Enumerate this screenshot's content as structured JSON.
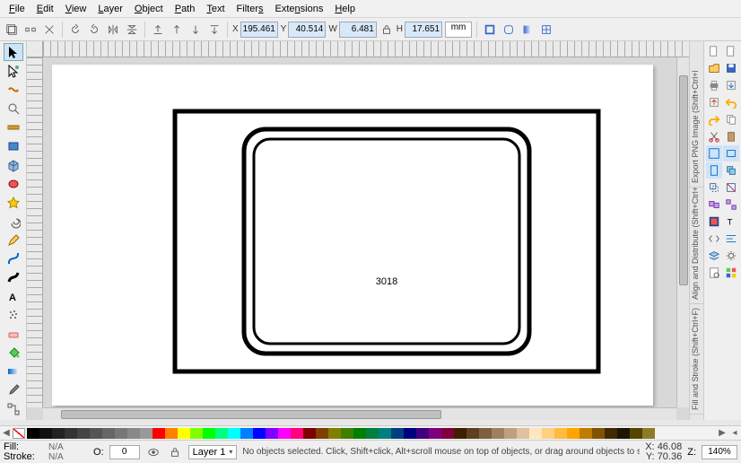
{
  "menu": {
    "items": [
      "File",
      "Edit",
      "View",
      "Layer",
      "Object",
      "Path",
      "Text",
      "Filters",
      "Extensions",
      "Help"
    ]
  },
  "toolbar": {
    "x_label": "X",
    "x_value": "195.461",
    "y_label": "Y",
    "y_value": "40.514",
    "w_label": "W",
    "w_value": "6.481",
    "h_label": "H",
    "h_value": "17.651",
    "unit": "mm"
  },
  "canvas": {
    "big_text": "3018"
  },
  "dock_tabs": [
    "Export PNG Image (Shift+Ctrl+E)",
    "Align and Distribute (Shift+Ctrl+A)",
    "Fill and Stroke (Shift+Ctrl+F)"
  ],
  "palette_colors": [
    "#000000",
    "#111111",
    "#222222",
    "#333333",
    "#444444",
    "#555555",
    "#666666",
    "#777777",
    "#888888",
    "#999999",
    "#ff0000",
    "#ff7f00",
    "#ffff00",
    "#7fff00",
    "#00ff00",
    "#00ff7f",
    "#00ffff",
    "#007fff",
    "#0000ff",
    "#7f00ff",
    "#ff00ff",
    "#ff007f",
    "#7f0000",
    "#7f3f00",
    "#7f7f00",
    "#3f7f00",
    "#007f00",
    "#007f3f",
    "#007f7f",
    "#003f7f",
    "#00007f",
    "#3f007f",
    "#7f007f",
    "#7f003f",
    "#3f1f00",
    "#5f3f1f",
    "#7f5f3f",
    "#9f7f5f",
    "#bf9f7f",
    "#dfc19f",
    "#ffe6bf",
    "#ffd080",
    "#ffba40",
    "#ffa500",
    "#c07c00",
    "#805300",
    "#402a00",
    "#201500",
    "#554400",
    "#8f7a27"
  ],
  "status": {
    "fill_label": "Fill:",
    "stroke_label": "Stroke:",
    "na": "N/A",
    "opacity_label": "O:",
    "opacity_value": "0",
    "layer_name": "Layer 1",
    "hint": "No objects selected. Click, Shift+click, Alt+scroll mouse on top of objects, or drag around objects to select.",
    "x_label": "X:",
    "y_label": "Y:",
    "x_value": "46.08",
    "y_value": "70.36",
    "z_label": "Z:",
    "zoom": "140%"
  }
}
